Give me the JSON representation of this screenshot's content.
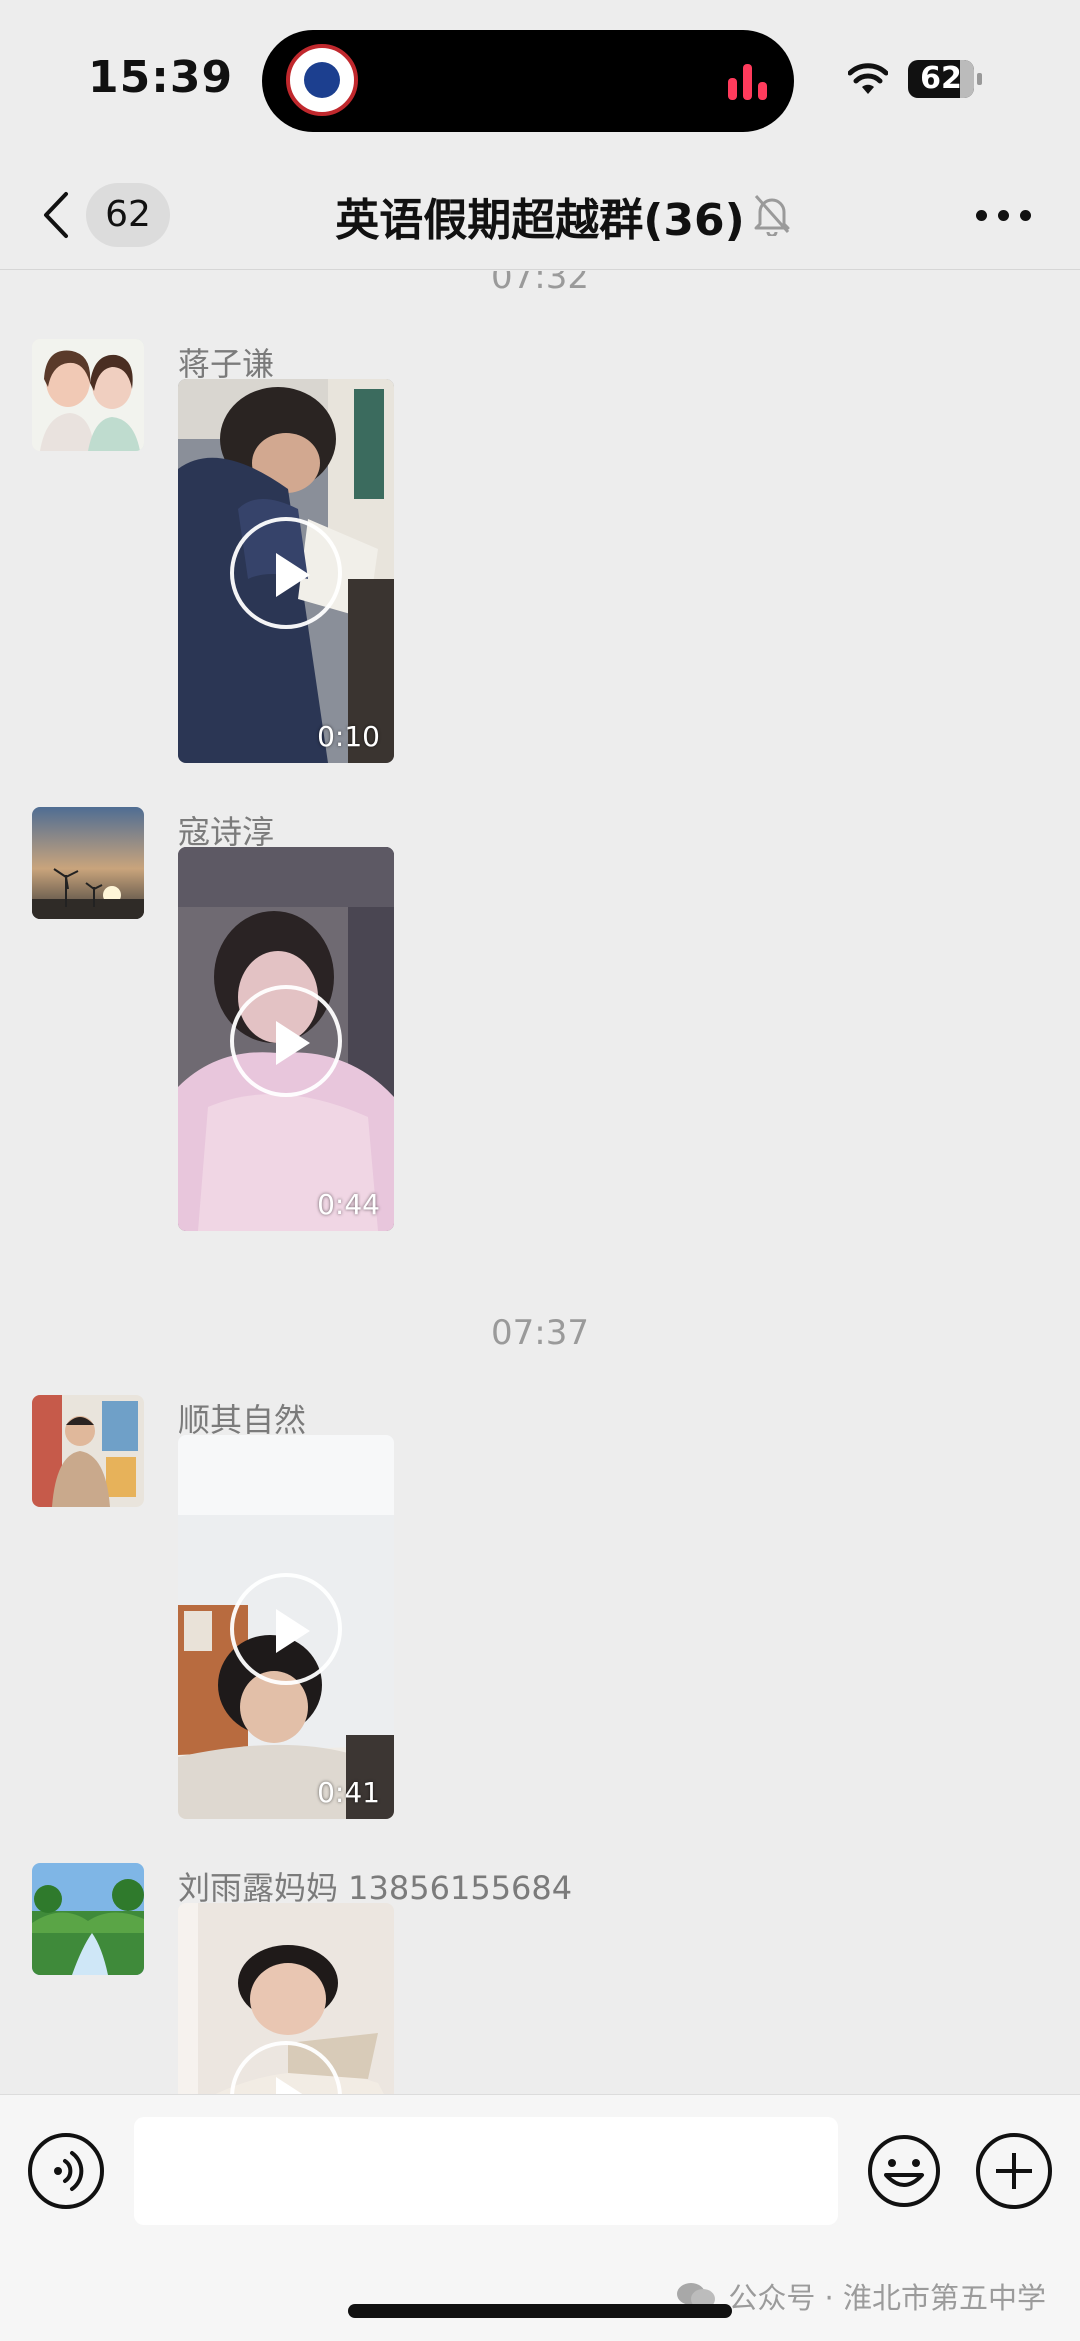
{
  "status_bar": {
    "time": "15:39",
    "battery": "62"
  },
  "nav": {
    "back_count": "62",
    "title": "英语假期超越群(36)"
  },
  "chat": {
    "timestamps": [
      "07:32",
      "07:37"
    ],
    "messages": [
      {
        "sender": "蒋子谦",
        "duration": "0:10"
      },
      {
        "sender": "寇诗淳",
        "duration": "0:44"
      },
      {
        "sender": "顺其自然",
        "duration": "0:41"
      },
      {
        "sender": "刘雨露妈妈 13856155684",
        "duration": ""
      }
    ]
  },
  "input": {
    "placeholder": ""
  },
  "watermark": {
    "text": "公众号 · 淮北市第五中学"
  },
  "colors": {
    "background": "#ededed",
    "secondary_text": "#9a9a9a",
    "accent_island": "#ff3b5c"
  }
}
